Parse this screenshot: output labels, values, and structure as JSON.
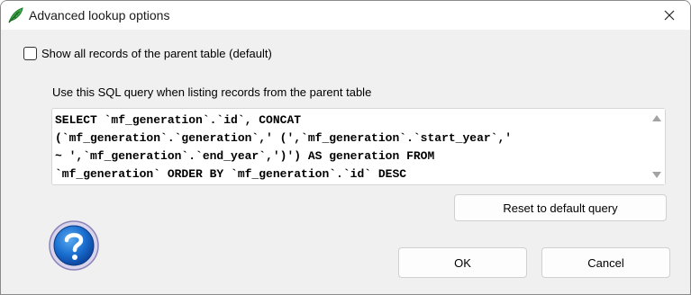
{
  "window": {
    "title": "Advanced lookup options",
    "icon": "feather-icon"
  },
  "checkbox": {
    "label": "Show all records of the parent table (default)",
    "checked": false
  },
  "sql": {
    "label": "Use this SQL query when listing records from the parent table",
    "query": "SELECT `mf_generation`.`id`, CONCAT\n(`mf_generation`.`generation`,' (',`mf_generation`.`start_year`,'\n~ ',`mf_generation`.`end_year`,')') AS generation FROM\n`mf_generation` ORDER BY `mf_generation`.`id` DESC"
  },
  "buttons": {
    "reset": "Reset to default query",
    "ok": "OK",
    "cancel": "Cancel"
  },
  "colors": {
    "window_bg": "#f0f0f0",
    "help_blue": "#1565c0"
  }
}
